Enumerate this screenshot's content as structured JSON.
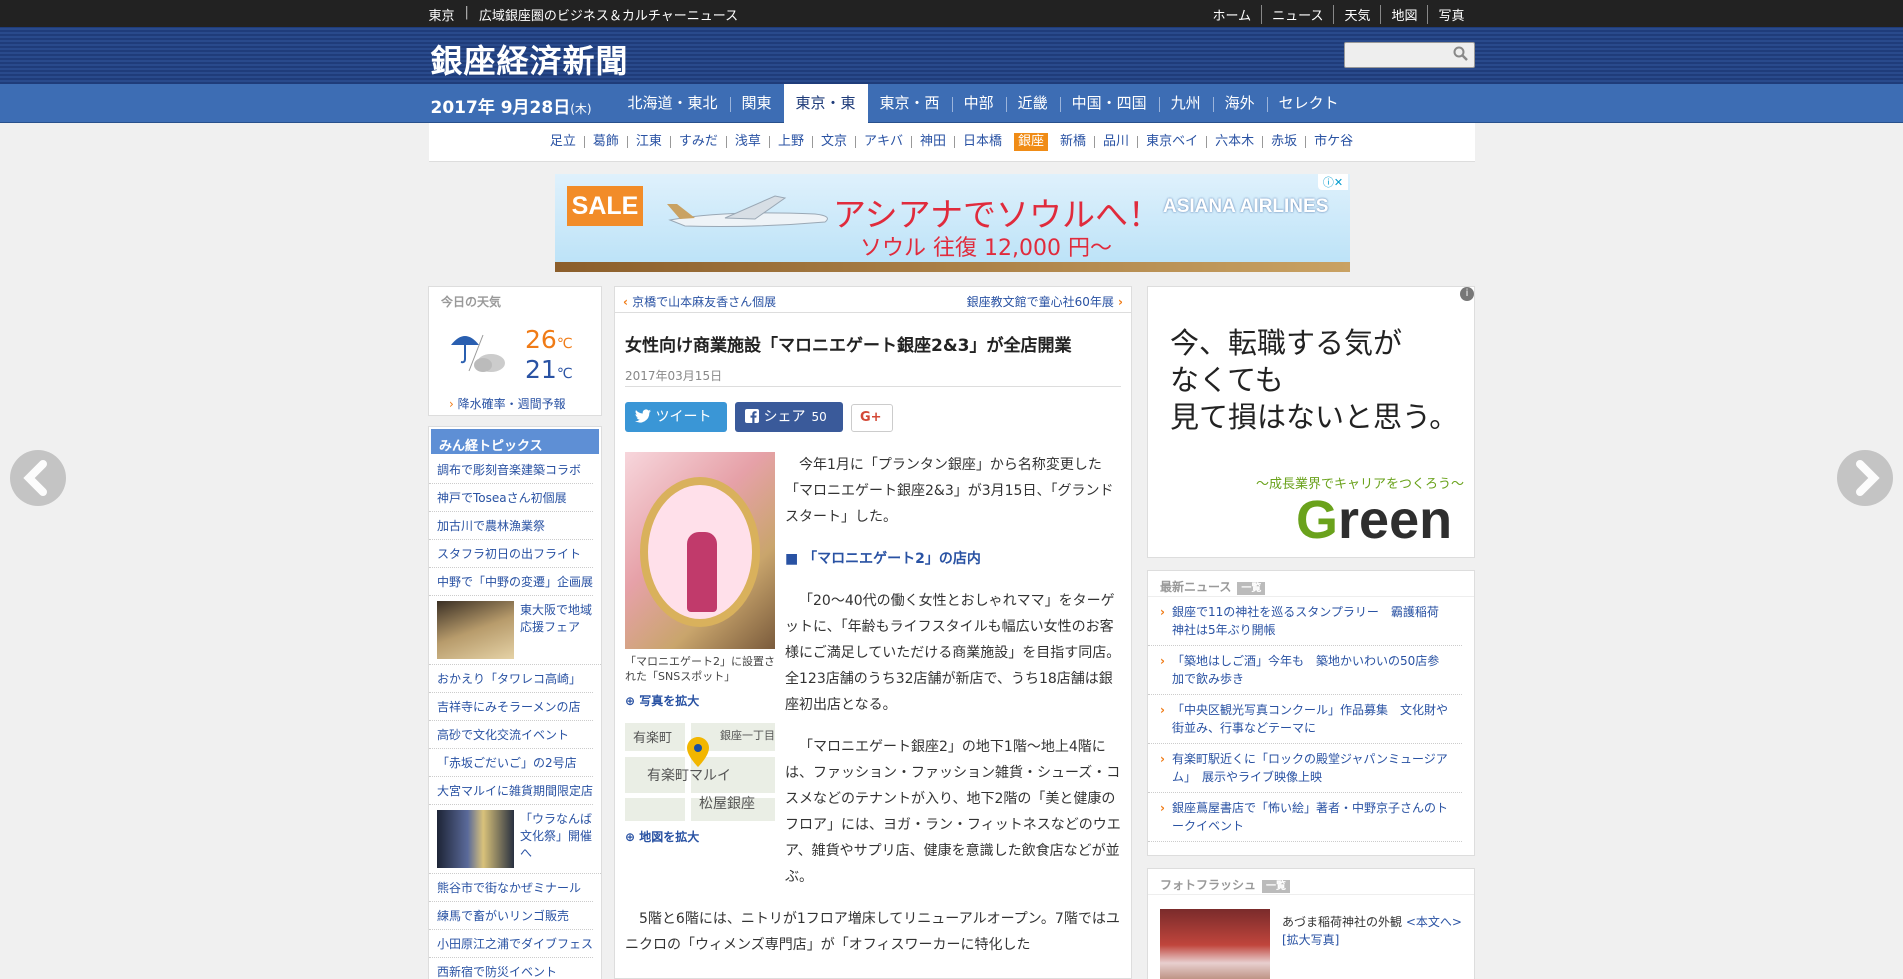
{
  "topbar": {
    "area": "東京",
    "tagline": "広域銀座圏のビジネス＆カルチャーニュース",
    "links": [
      "ホーム",
      "ニュース",
      "天気",
      "地図",
      "写真"
    ]
  },
  "header": {
    "logo": "銀座経済新聞",
    "search_placeholder": ""
  },
  "date": {
    "main": "2017年 9月28日",
    "weekday": "(木)"
  },
  "regions": [
    "北海道・東北",
    "関東",
    "東京・東",
    "東京・西",
    "中部",
    "近畿",
    "中国・四国",
    "九州",
    "海外",
    "セレクト"
  ],
  "active_region": "東京・東",
  "subnav": [
    "足立",
    "葛飾",
    "江東",
    "すみだ",
    "浅草",
    "上野",
    "文京",
    "アキバ",
    "神田",
    "日本橋",
    "銀座",
    "新橋",
    "品川",
    "東京ベイ",
    "六本木",
    "赤坂",
    "市ケ谷"
  ],
  "active_sub": "銀座",
  "banner": {
    "sale": "SALE",
    "headline": "アシアナでソウルへ！",
    "airline": "ASIANA AIRLINES",
    "price": "ソウル 往復 12,000 円〜"
  },
  "weather": {
    "title": "今日の天気",
    "high": "26",
    "low": "21",
    "unit": "℃",
    "link": "降水確率・週間予報"
  },
  "topics": {
    "title": "みん経トピックス",
    "items": [
      {
        "text": "調布で彫刻音楽建築コラボ"
      },
      {
        "text": "神戸でToseaさん初個展"
      },
      {
        "text": "加古川で農林漁業祭"
      },
      {
        "text": "スタフラ初日の出フライト"
      },
      {
        "text": "中野で「中野の変遷」企画展"
      },
      {
        "text": "東大阪で地域応援フェア",
        "thumb": true
      },
      {
        "text": "おかえり「タワレコ高崎」"
      },
      {
        "text": "吉祥寺にみそラーメンの店"
      },
      {
        "text": "高砂で文化交流イベント"
      },
      {
        "text": "「赤坂ごだいご」の2号店"
      },
      {
        "text": "大宮マルイに雑貨期間限定店"
      },
      {
        "text": "「ウラなんば文化祭」開催へ",
        "thumb": true
      },
      {
        "text": "熊谷市で街なかぜミナール"
      },
      {
        "text": "練馬で畜がいリンゴ販売"
      },
      {
        "text": "小田原江之浦でダイブフェス"
      },
      {
        "text": "西新宿で防災イベント"
      }
    ]
  },
  "article": {
    "prev": "京橋で山本麻友香さん個展",
    "next": "銀座教文館で童心社60年展",
    "title": "女性向け商業施設「マロニエゲート銀座2&3」が全店開業",
    "date": "2017年03月15日",
    "tweet": "ツイート",
    "share": "シェア",
    "share_count": "50",
    "gplus": "G+",
    "photo_caption": "「マロニエゲート2」に設置された「SNSスポット」",
    "zoom_photo": "写真を拡大",
    "zoom_map": "地図を拡大",
    "map_labels": [
      "有楽町",
      "有楽町マルイ",
      "松屋銀座",
      "銀座一丁目"
    ],
    "paragraphs": [
      "今年1月に「プランタン銀座」から名称変更した「マロニエゲート銀座2&3」が3月15日、「グランドスタート」した。",
      "「マロニエゲート2」の店内",
      "「20～40代の働く女性とおしゃれママ」をターゲットに、「年齢もライフスタイルも幅広い女性のお客様にご満足していただける商業施設」を目指す同店。全123店舗のうち32店舗が新店で、うち18店舗は銀座初出店となる。",
      "「マロニエゲート銀座2」の地下1階～地上4階には、ファッション・ファッション雑貨・シューズ・コスメなどのテナントが入り、地下2階の「美と健康のフロア」には、ヨガ・ラン・フィットネスなどのウエア、雑貨やサプリ店、健康を意識した飲食店などが並ぶ。",
      "5階と6階には、ニトリが1フロア増床してリニューアルオープン。7階ではユニクロの「ウィメンズ専門店」が「オフィスワーカーに特化した"
    ]
  },
  "right_ad": {
    "copy": [
      "今、転職する気が",
      "なくても",
      "見て損はないと思う。"
    ],
    "tag": "〜成長業界でキャリアをつくろう〜",
    "brand_first": "G",
    "brand_rest": "reen"
  },
  "latest": {
    "title": "最新ニュース",
    "list_label": "一覧",
    "items": [
      "銀座で11の神社を巡るスタンプラリー　霸護稲荷神社は5年ぶり開帳",
      "「築地はしご酒」今年も　築地かいわいの50店参加で飲み歩き",
      "「中央区観光写真コンクール」作品募集　文化財や街並み、行事などテーマに",
      "有楽町駅近くに「ロックの殿堂ジャパンミュージアム」　展示やライブ映像上映",
      "銀座蔦屋書店で「怖い絵」著者・中野京子さんのトークイベント"
    ]
  },
  "photoflash": {
    "title": "フォトフラッシュ",
    "list_label": "一覧",
    "caption": "あづま稲荷神社の外観",
    "more": "<本文へ>",
    "zoom": "[拡大写真]"
  }
}
